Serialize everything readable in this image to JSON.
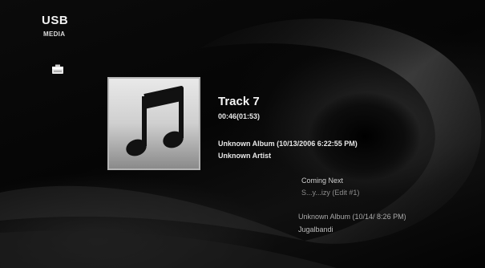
{
  "source": {
    "title": "USB",
    "subtitle": "MEDIA",
    "icon": "usb-drive-icon"
  },
  "now_playing": {
    "art_icon": "music-note-icon",
    "track": "Track 7",
    "time": "00:46(01:53)",
    "album": "Unknown Album (10/13/2006 6:22:55 PM)",
    "artist": "Unknown Artist"
  },
  "coming_next": {
    "heading": "Coming Next",
    "track": "S...y...izy (Edit #1)",
    "album": "Unknown Album (10/14/ 8:26 PM)",
    "artist": "Jugalbandi"
  },
  "colors": {
    "background": "#000000",
    "text": "#ffffff",
    "muted_text": "#8e8e8e"
  }
}
